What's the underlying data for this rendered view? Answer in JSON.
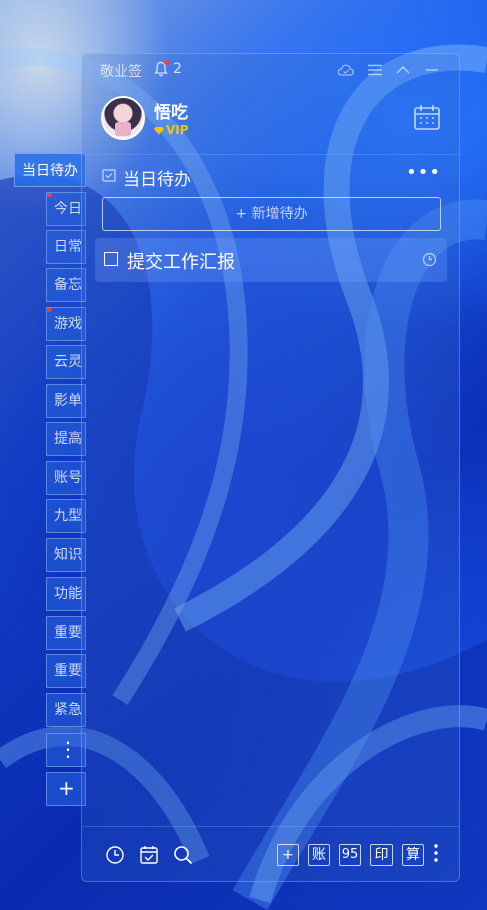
{
  "app": {
    "name": "敬业签",
    "notification_count": "2"
  },
  "user": {
    "name": "悟吃",
    "badge": "VIP"
  },
  "side_tabs": {
    "active": "当日待办",
    "items": [
      {
        "label": "今日",
        "dot": true
      },
      {
        "label": "日常",
        "dot": false
      },
      {
        "label": "备忘",
        "dot": false
      },
      {
        "label": "游戏",
        "dot": true
      },
      {
        "label": "云灵",
        "dot": false
      },
      {
        "label": "影单",
        "dot": false
      },
      {
        "label": "提高",
        "dot": false
      },
      {
        "label": "账号",
        "dot": false
      },
      {
        "label": "九型",
        "dot": false
      },
      {
        "label": "知识",
        "dot": false
      },
      {
        "label": "功能",
        "dot": false
      },
      {
        "label": "重要",
        "dot": false
      },
      {
        "label": "重要",
        "dot": false
      },
      {
        "label": "紧急",
        "dot": false
      }
    ],
    "more": "⋮",
    "add": "+"
  },
  "section": {
    "title": "当日待办",
    "more": "•••"
  },
  "add_todo": {
    "label": "+ 新增待办"
  },
  "todos": [
    {
      "text": "提交工作汇报"
    }
  ],
  "footer": {
    "buttons": [
      {
        "label": "+"
      },
      {
        "label": "账"
      },
      {
        "label": "95"
      },
      {
        "label": "印"
      },
      {
        "label": "算"
      }
    ],
    "more": "⋮"
  },
  "colors": {
    "accent": "#f7c600",
    "notify": "#ff3b3b",
    "panel_border": "#aac8ff"
  }
}
